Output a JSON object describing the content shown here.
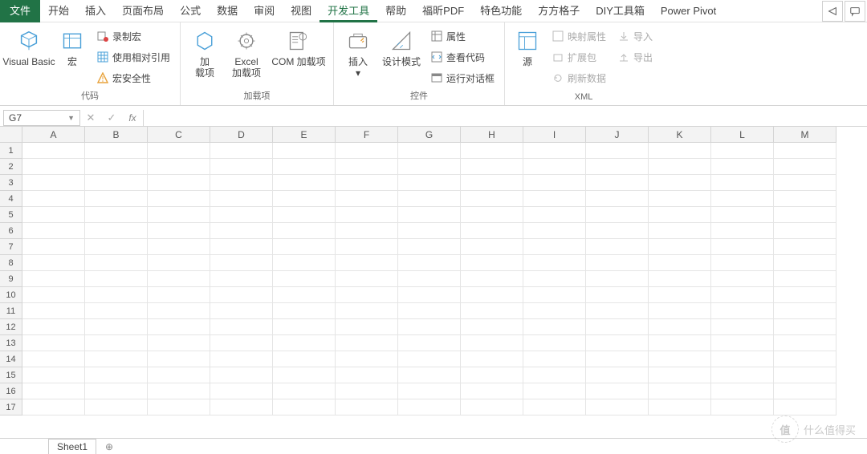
{
  "tabs": {
    "file": "文件",
    "items": [
      "开始",
      "插入",
      "页面布局",
      "公式",
      "数据",
      "审阅",
      "视图",
      "开发工具",
      "帮助",
      "福昕PDF",
      "特色功能",
      "方方格子",
      "DIY工具箱",
      "Power Pivot"
    ],
    "active_index": 7
  },
  "ribbon": {
    "groups": [
      {
        "label": "代码",
        "big": [
          {
            "id": "vb",
            "label": "Visual Basic"
          },
          {
            "id": "macro",
            "label": "宏"
          }
        ],
        "small": [
          {
            "id": "rec",
            "label": "录制宏"
          },
          {
            "id": "rel",
            "label": "使用相对引用"
          },
          {
            "id": "sec",
            "label": "宏安全性"
          }
        ]
      },
      {
        "label": "加载项",
        "big": [
          {
            "id": "addin",
            "label": "加\n载项"
          },
          {
            "id": "exceladdin",
            "label": "Excel\n加载项"
          },
          {
            "id": "com",
            "label": "COM 加载项"
          }
        ]
      },
      {
        "label": "控件",
        "big": [
          {
            "id": "insert",
            "label": "插入\n▾"
          },
          {
            "id": "design",
            "label": "设计模式"
          }
        ],
        "small": [
          {
            "id": "prop",
            "label": "属性"
          },
          {
            "id": "viewcode",
            "label": "查看代码"
          },
          {
            "id": "dialog",
            "label": "运行对话框"
          }
        ]
      },
      {
        "label": "XML",
        "big": [
          {
            "id": "src",
            "label": "源"
          }
        ],
        "small_cols": [
          [
            {
              "id": "mapprop",
              "label": "映射属性",
              "dis": true
            },
            {
              "id": "expand",
              "label": "扩展包",
              "dis": true
            },
            {
              "id": "refresh",
              "label": "刷新数据",
              "dis": true
            }
          ],
          [
            {
              "id": "import",
              "label": "导入",
              "dis": true
            },
            {
              "id": "export",
              "label": "导出",
              "dis": true
            }
          ]
        ]
      }
    ]
  },
  "formula_bar": {
    "cell_ref": "G7",
    "value": ""
  },
  "grid": {
    "columns": [
      "A",
      "B",
      "C",
      "D",
      "E",
      "F",
      "G",
      "H",
      "I",
      "J",
      "K",
      "L",
      "M"
    ],
    "rows": [
      1,
      2,
      3,
      4,
      5,
      6,
      7,
      8,
      9,
      10,
      11,
      12,
      13,
      14,
      15,
      16,
      17
    ]
  },
  "sheets": {
    "active": "Sheet1"
  },
  "watermark": {
    "logo": "值",
    "text": "什么值得买"
  }
}
